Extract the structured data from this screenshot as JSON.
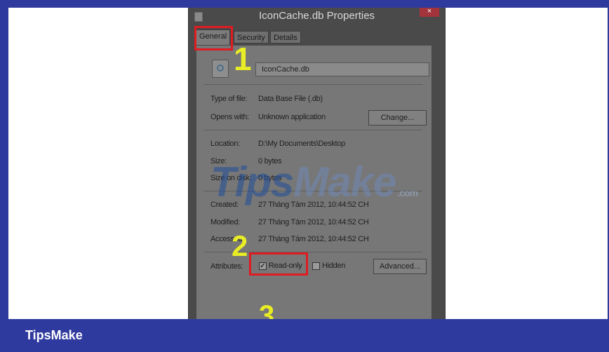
{
  "window": {
    "title": "IconCache.db Properties",
    "close_glyph": "×"
  },
  "tabs": [
    {
      "label": "General"
    },
    {
      "label": "Security"
    },
    {
      "label": "Details"
    }
  ],
  "general": {
    "file_name": "IconCache.db",
    "type_label": "Type of file:",
    "type_value": "Data Base File (.db)",
    "opens_label": "Opens with:",
    "opens_value": "Unknown application",
    "change_button": "Change...",
    "location_label": "Location:",
    "location_value": "D:\\My Documents\\Desktop",
    "size_label": "Size:",
    "size_value": "0 bytes",
    "size_disk_label": "Size on disk:",
    "size_disk_value": "0 bytes",
    "created_label": "Created:",
    "created_value": "27 Tháng Tám 2012, 10:44:52 CH",
    "modified_label": "Modified:",
    "modified_value": "27 Tháng Tám 2012, 10:44:52 CH",
    "accessed_label": "Accessed:",
    "accessed_value": "27 Tháng Tám 2012, 10:44:52 CH",
    "attributes_label": "Attributes:",
    "readonly_label": "Read-only",
    "readonly_checked": true,
    "readonly_check_glyph": "✓",
    "hidden_label": "Hidden",
    "hidden_checked": false,
    "advanced_button": "Advanced..."
  },
  "annotations": {
    "step1": "1",
    "step2": "2",
    "step3": "3",
    "highlight_color": "#e01b22",
    "number_color": "#e9ed25"
  },
  "watermark": {
    "part1": "Tips",
    "part2": "Make",
    "suffix": ".com"
  },
  "footer": {
    "brand": "TipsMake"
  }
}
